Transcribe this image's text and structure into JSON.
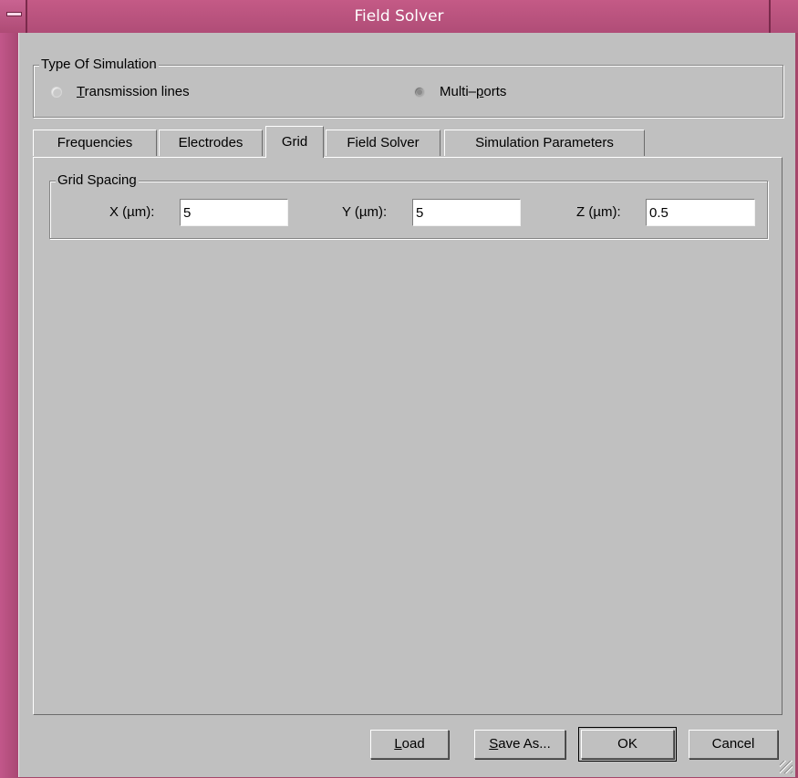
{
  "window": {
    "title": "Field Solver"
  },
  "simulation_type": {
    "legend": "Type Of Simulation",
    "options": [
      {
        "label": "Transmission lines",
        "mnemonic": "T",
        "rest": "ransmission lines",
        "selected": false
      },
      {
        "label": "Multi–ports",
        "pre": "Multi–",
        "mnemonic": "p",
        "rest": "orts",
        "selected": true
      }
    ]
  },
  "tabs": [
    {
      "label": "Frequencies",
      "active": false
    },
    {
      "label": "Electrodes",
      "active": false
    },
    {
      "label": "Grid",
      "active": true
    },
    {
      "label": "Field Solver",
      "active": false
    },
    {
      "label": "Simulation Parameters",
      "active": false
    }
  ],
  "grid_spacing": {
    "legend": "Grid Spacing",
    "x": {
      "label": "X  (µm):",
      "value": "5"
    },
    "y": {
      "label": "Y  (µm):",
      "value": "5"
    },
    "z": {
      "label": "Z  (µm):",
      "value": "0.5"
    }
  },
  "buttons": {
    "load": {
      "mnemonic": "L",
      "rest": "oad"
    },
    "save_as": {
      "mnemonic": "S",
      "rest": "ave As..."
    },
    "ok": "OK",
    "cancel": "Cancel"
  },
  "colors": {
    "titlebar": "#b04d77",
    "panel": "#c0c0c0"
  }
}
